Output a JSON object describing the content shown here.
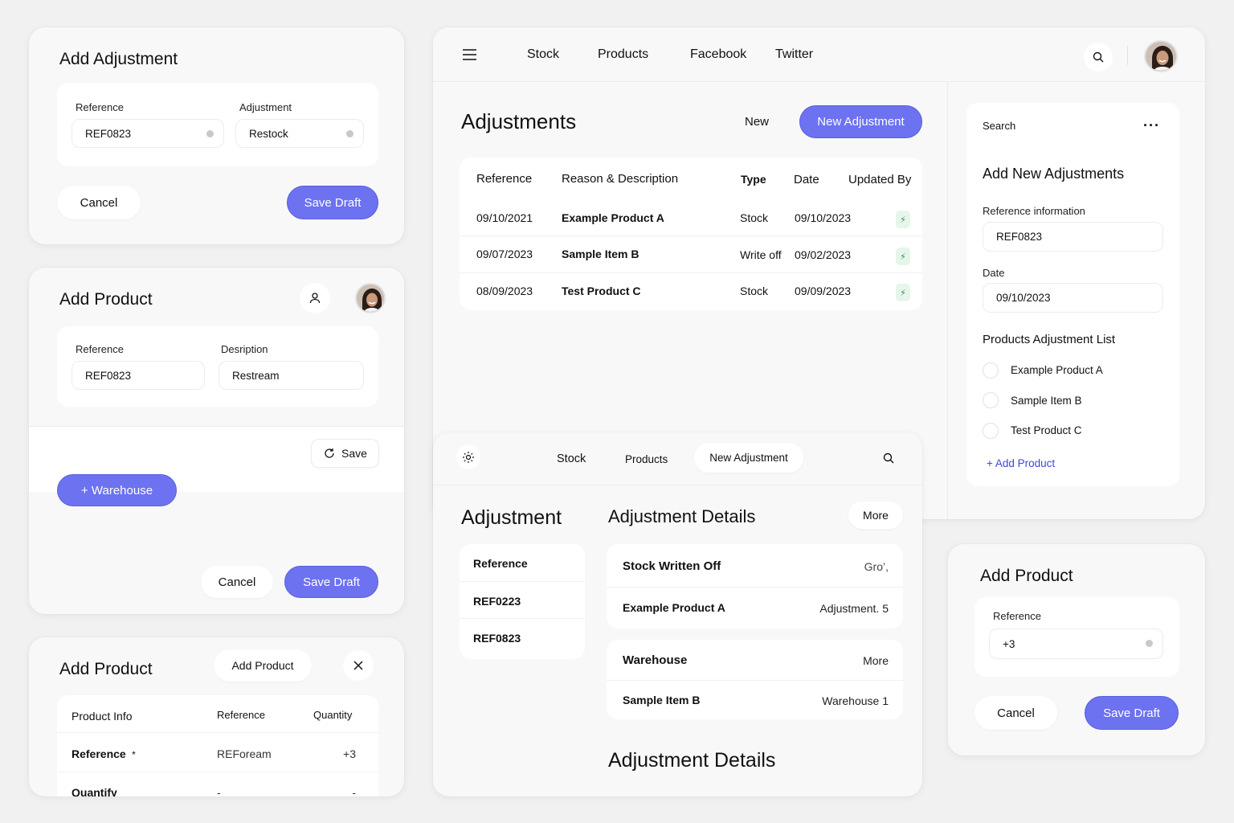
{
  "add_adjustment_card": {
    "title": "Add Adjustment",
    "reference_label": "Reference",
    "reference_value": "REF0823",
    "adjustment_label": "Adjustment",
    "adjustment_value": "Restock",
    "cancel": "Cancel",
    "save_draft": "Save Draft"
  },
  "add_product_card": {
    "title": "Add Product",
    "reference_label": "Reference",
    "reference_value": "REF0823",
    "description_label": "Desription",
    "description_value": "Restream",
    "save": "Save",
    "warehouse": "+ Warehouse",
    "cancel": "Cancel",
    "save_draft": "Save Draft"
  },
  "add_product_table_card": {
    "title": "Add Product",
    "add_product_button": "Add Product",
    "headers": [
      "Product Info",
      "Reference",
      "Quantity"
    ],
    "rows": [
      {
        "label": "Reference",
        "required": "*",
        "reference": "REFoream",
        "quantity": "+3"
      },
      {
        "label": "Quantify",
        "reference": "-",
        "quantity": "-"
      }
    ]
  },
  "top_nav": {
    "items": [
      "Stock",
      "Products",
      "Facebook",
      "Twitter"
    ]
  },
  "adjustments": {
    "title": "Adjustments",
    "new_label": "New",
    "new_adjustment": "New Adjustment",
    "headers": [
      "Reference",
      "Reason & Description",
      "Type",
      "Date",
      "Updated By"
    ],
    "rows": [
      {
        "reference": "09/10/2021",
        "reason": "Example Product A",
        "type": "Stock",
        "date": "09/10/2023"
      },
      {
        "reference": "09/07/2023",
        "reason": "Sample Item B",
        "type": "Write off",
        "date": "09/02/2023"
      },
      {
        "reference": "08/09/2023",
        "reason": "Test Product C",
        "type": "Stock",
        "date": "09/09/2023"
      }
    ]
  },
  "side_panel": {
    "search": "Search",
    "title": "Add New Adjustments",
    "reference_info_label": "Reference information",
    "reference_info_value": "REF0823",
    "date_label": "Date",
    "date_value": "09/10/2023",
    "list_title": "Products Adjustment List",
    "list_items": [
      "Example Product A",
      "Sample Item B",
      "Test Product C"
    ],
    "add_product": "+ Add Product"
  },
  "detail_nav": {
    "items": [
      "Stock",
      "Products",
      "New Adjustment"
    ]
  },
  "adjustment_detail": {
    "left_title": "Adjustment",
    "reference_header": "Reference",
    "references": [
      "REF0223",
      "REF0823"
    ],
    "details_title": "Adjustment Details",
    "more": "More",
    "block1": [
      {
        "left": "Stock Written Off",
        "right": "Gro’,"
      },
      {
        "left": "Example Product A",
        "right": "Adjustment. 5"
      }
    ],
    "block2": [
      {
        "left": "Warehouse",
        "right": "More"
      },
      {
        "left": "Sample Item B",
        "right": "Warehouse 1"
      }
    ],
    "bottom_title": "Adjustment Details"
  },
  "add_product_small": {
    "title": "Add Product",
    "reference_label": "Reference",
    "reference_value": "+3",
    "cancel": "Cancel",
    "save_draft": "Save Draft"
  }
}
